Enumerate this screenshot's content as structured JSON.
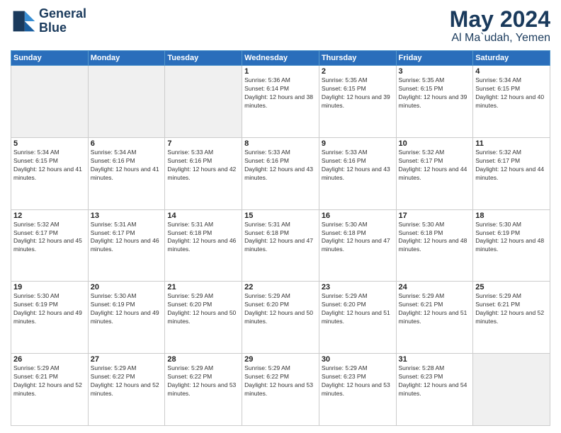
{
  "logo": {
    "line1": "General",
    "line2": "Blue"
  },
  "title": "May 2024",
  "subtitle": "Al Ma`udah, Yemen",
  "days_header": [
    "Sunday",
    "Monday",
    "Tuesday",
    "Wednesday",
    "Thursday",
    "Friday",
    "Saturday"
  ],
  "weeks": [
    [
      {
        "day": "",
        "empty": true
      },
      {
        "day": "",
        "empty": true
      },
      {
        "day": "",
        "empty": true
      },
      {
        "day": "1",
        "sunrise": "5:36 AM",
        "sunset": "6:14 PM",
        "daylight": "12 hours and 38 minutes."
      },
      {
        "day": "2",
        "sunrise": "5:35 AM",
        "sunset": "6:15 PM",
        "daylight": "12 hours and 39 minutes."
      },
      {
        "day": "3",
        "sunrise": "5:35 AM",
        "sunset": "6:15 PM",
        "daylight": "12 hours and 39 minutes."
      },
      {
        "day": "4",
        "sunrise": "5:34 AM",
        "sunset": "6:15 PM",
        "daylight": "12 hours and 40 minutes."
      }
    ],
    [
      {
        "day": "5",
        "sunrise": "5:34 AM",
        "sunset": "6:15 PM",
        "daylight": "12 hours and 41 minutes."
      },
      {
        "day": "6",
        "sunrise": "5:34 AM",
        "sunset": "6:16 PM",
        "daylight": "12 hours and 41 minutes."
      },
      {
        "day": "7",
        "sunrise": "5:33 AM",
        "sunset": "6:16 PM",
        "daylight": "12 hours and 42 minutes."
      },
      {
        "day": "8",
        "sunrise": "5:33 AM",
        "sunset": "6:16 PM",
        "daylight": "12 hours and 43 minutes."
      },
      {
        "day": "9",
        "sunrise": "5:33 AM",
        "sunset": "6:16 PM",
        "daylight": "12 hours and 43 minutes."
      },
      {
        "day": "10",
        "sunrise": "5:32 AM",
        "sunset": "6:17 PM",
        "daylight": "12 hours and 44 minutes."
      },
      {
        "day": "11",
        "sunrise": "5:32 AM",
        "sunset": "6:17 PM",
        "daylight": "12 hours and 44 minutes."
      }
    ],
    [
      {
        "day": "12",
        "sunrise": "5:32 AM",
        "sunset": "6:17 PM",
        "daylight": "12 hours and 45 minutes."
      },
      {
        "day": "13",
        "sunrise": "5:31 AM",
        "sunset": "6:17 PM",
        "daylight": "12 hours and 46 minutes."
      },
      {
        "day": "14",
        "sunrise": "5:31 AM",
        "sunset": "6:18 PM",
        "daylight": "12 hours and 46 minutes."
      },
      {
        "day": "15",
        "sunrise": "5:31 AM",
        "sunset": "6:18 PM",
        "daylight": "12 hours and 47 minutes."
      },
      {
        "day": "16",
        "sunrise": "5:30 AM",
        "sunset": "6:18 PM",
        "daylight": "12 hours and 47 minutes."
      },
      {
        "day": "17",
        "sunrise": "5:30 AM",
        "sunset": "6:18 PM",
        "daylight": "12 hours and 48 minutes."
      },
      {
        "day": "18",
        "sunrise": "5:30 AM",
        "sunset": "6:19 PM",
        "daylight": "12 hours and 48 minutes."
      }
    ],
    [
      {
        "day": "19",
        "sunrise": "5:30 AM",
        "sunset": "6:19 PM",
        "daylight": "12 hours and 49 minutes."
      },
      {
        "day": "20",
        "sunrise": "5:30 AM",
        "sunset": "6:19 PM",
        "daylight": "12 hours and 49 minutes."
      },
      {
        "day": "21",
        "sunrise": "5:29 AM",
        "sunset": "6:20 PM",
        "daylight": "12 hours and 50 minutes."
      },
      {
        "day": "22",
        "sunrise": "5:29 AM",
        "sunset": "6:20 PM",
        "daylight": "12 hours and 50 minutes."
      },
      {
        "day": "23",
        "sunrise": "5:29 AM",
        "sunset": "6:20 PM",
        "daylight": "12 hours and 51 minutes."
      },
      {
        "day": "24",
        "sunrise": "5:29 AM",
        "sunset": "6:21 PM",
        "daylight": "12 hours and 51 minutes."
      },
      {
        "day": "25",
        "sunrise": "5:29 AM",
        "sunset": "6:21 PM",
        "daylight": "12 hours and 52 minutes."
      }
    ],
    [
      {
        "day": "26",
        "sunrise": "5:29 AM",
        "sunset": "6:21 PM",
        "daylight": "12 hours and 52 minutes."
      },
      {
        "day": "27",
        "sunrise": "5:29 AM",
        "sunset": "6:22 PM",
        "daylight": "12 hours and 52 minutes."
      },
      {
        "day": "28",
        "sunrise": "5:29 AM",
        "sunset": "6:22 PM",
        "daylight": "12 hours and 53 minutes."
      },
      {
        "day": "29",
        "sunrise": "5:29 AM",
        "sunset": "6:22 PM",
        "daylight": "12 hours and 53 minutes."
      },
      {
        "day": "30",
        "sunrise": "5:29 AM",
        "sunset": "6:23 PM",
        "daylight": "12 hours and 53 minutes."
      },
      {
        "day": "31",
        "sunrise": "5:28 AM",
        "sunset": "6:23 PM",
        "daylight": "12 hours and 54 minutes."
      },
      {
        "day": "",
        "empty": true
      }
    ]
  ]
}
